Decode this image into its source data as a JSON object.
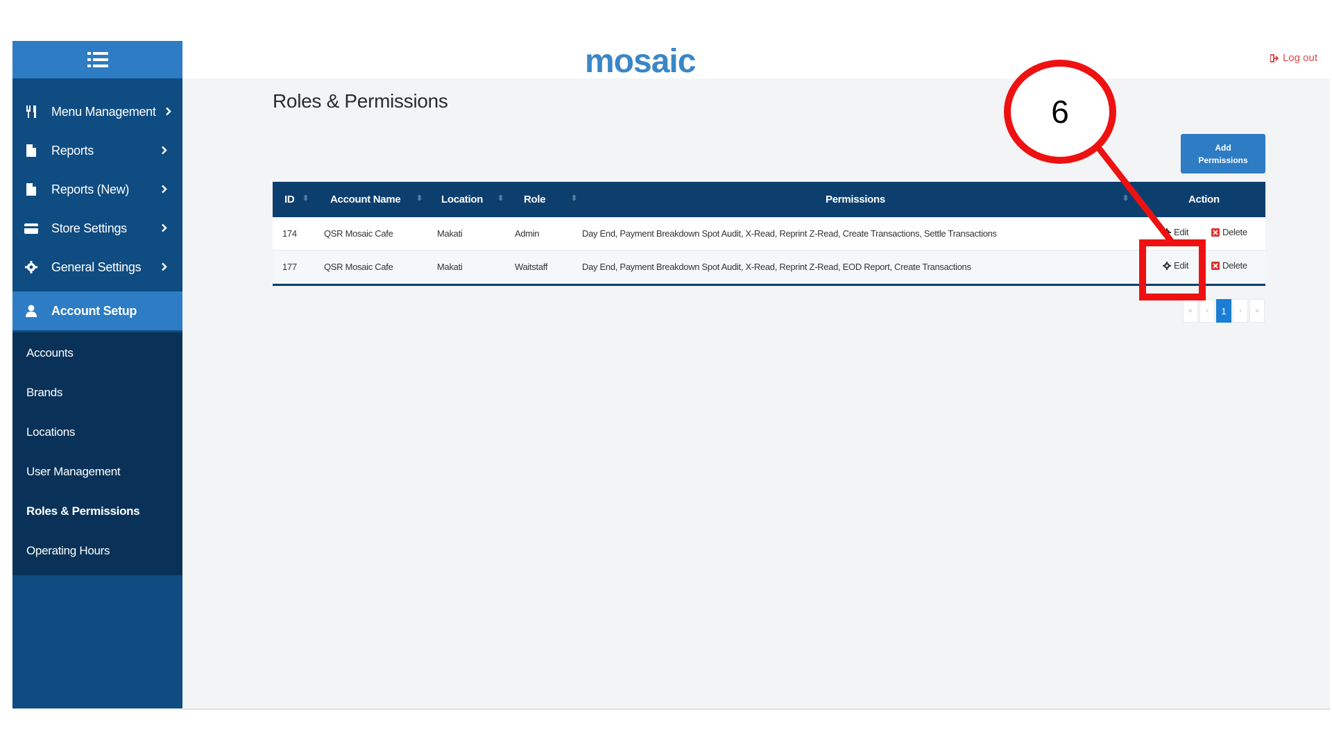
{
  "header": {
    "logo": "mosaic",
    "logout_label": "Log out"
  },
  "sidebar": {
    "items": [
      {
        "label": "Menu Management",
        "icon": "utensils-icon"
      },
      {
        "label": "Reports",
        "icon": "file-icon"
      },
      {
        "label": "Reports (New)",
        "icon": "file-icon"
      },
      {
        "label": "Store Settings",
        "icon": "card-icon"
      },
      {
        "label": "General Settings",
        "icon": "gear-icon"
      },
      {
        "label": "Account Setup",
        "icon": "user-icon"
      }
    ],
    "submenu": [
      "Accounts",
      "Brands",
      "Locations",
      "User Management",
      "Roles & Permissions",
      "Operating Hours"
    ]
  },
  "page": {
    "title": "Roles & Permissions",
    "add_button_label": "Add Permissions"
  },
  "table": {
    "columns": [
      "ID",
      "Account Name",
      "Location",
      "Role",
      "Permissions",
      "Action"
    ],
    "rows": [
      {
        "id": "174",
        "account": "QSR Mosaic Cafe",
        "location": "Makati",
        "role": "Admin",
        "permissions": "Day End, Payment Breakdown Spot Audit, X-Read, Reprint Z-Read, Create Transactions, Settle Transactions"
      },
      {
        "id": "177",
        "account": "QSR Mosaic Cafe",
        "location": "Makati",
        "role": "Waitstaff",
        "permissions": "Day End, Payment Breakdown Spot Audit, X-Read, Reprint Z-Read, EOD Report, Create Transactions"
      }
    ],
    "edit_label": "Edit",
    "delete_label": "Delete"
  },
  "pagination": {
    "first": "«",
    "prev": "‹",
    "current": "1",
    "next": "›",
    "last": "»"
  },
  "annotation": {
    "step_number": "6",
    "color": "#ee1111"
  },
  "colors": {
    "sidebar": "#0f4c81",
    "sidebar_active": "#2d7cc4",
    "table_header": "#0d3f6e",
    "accent": "#2d7cc4",
    "logout": "#e04a4a"
  }
}
